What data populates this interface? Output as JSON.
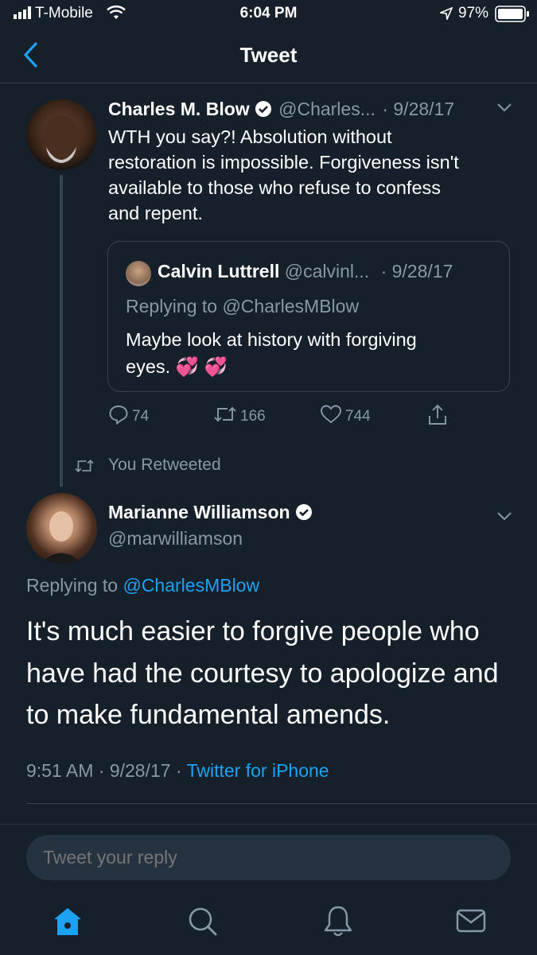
{
  "status_bar": {
    "carrier": "T-Mobile",
    "time": "6:04 PM",
    "battery": "97%"
  },
  "header": {
    "title": "Tweet",
    "back_icon": "chevron-left-icon"
  },
  "parent_tweet": {
    "name": "Charles M. Blow",
    "handle": "@Charles...",
    "date": "· 9/28/17",
    "text_lines": [
      "WTH you say?! Absolution without",
      "restoration is impossible. Forgiveness isn't",
      "available to those who refuse to confess",
      "and repent."
    ],
    "quoted": {
      "name": "Calvin Luttrell",
      "handle": "@calvinl...",
      "date": "· 9/28/17",
      "replying": "Replying to @CharlesMBlow",
      "text_lines": [
        "Maybe look at history with forgiving",
        "eyes. 💞 💞"
      ]
    },
    "actions": {
      "replies": "74",
      "retweets": "166",
      "likes": "744"
    }
  },
  "retweet_note": "You Retweeted",
  "main_tweet": {
    "name": "Marianne Williamson",
    "handle": "@marwilliamson",
    "replying_prefix": "Replying to",
    "replying_to": "@CharlesMBlow",
    "text_lines": [
      "It's much easier to forgive people who",
      "have had the courtesy to apologize and",
      "to make fundamental amends."
    ],
    "time": "9:51 AM · 9/28/17 ·",
    "source": "Twitter for iPhone"
  },
  "reply": {
    "placeholder": "Tweet your reply"
  },
  "tabs": [
    "home-icon",
    "search-icon",
    "bell-icon",
    "mail-icon"
  ],
  "colors": {
    "background": "#15202b",
    "accent": "#1da1f2",
    "muted": "#8899a6"
  }
}
